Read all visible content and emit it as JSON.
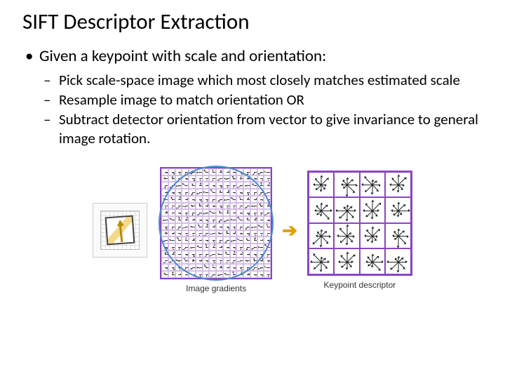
{
  "title": "SIFT Descriptor Extraction",
  "bullets": {
    "b1": "Given a keypoint with scale and orientation:",
    "sub": {
      "s1": "Pick scale-space image which most closely matches estimated scale",
      "s2": "Resample image to match orientation OR",
      "s3": "Subtract detector orientation from vector to give invariance to general image rotation."
    }
  },
  "captions": {
    "gradients": "Image gradients",
    "descriptor": "Keypoint descriptor"
  }
}
